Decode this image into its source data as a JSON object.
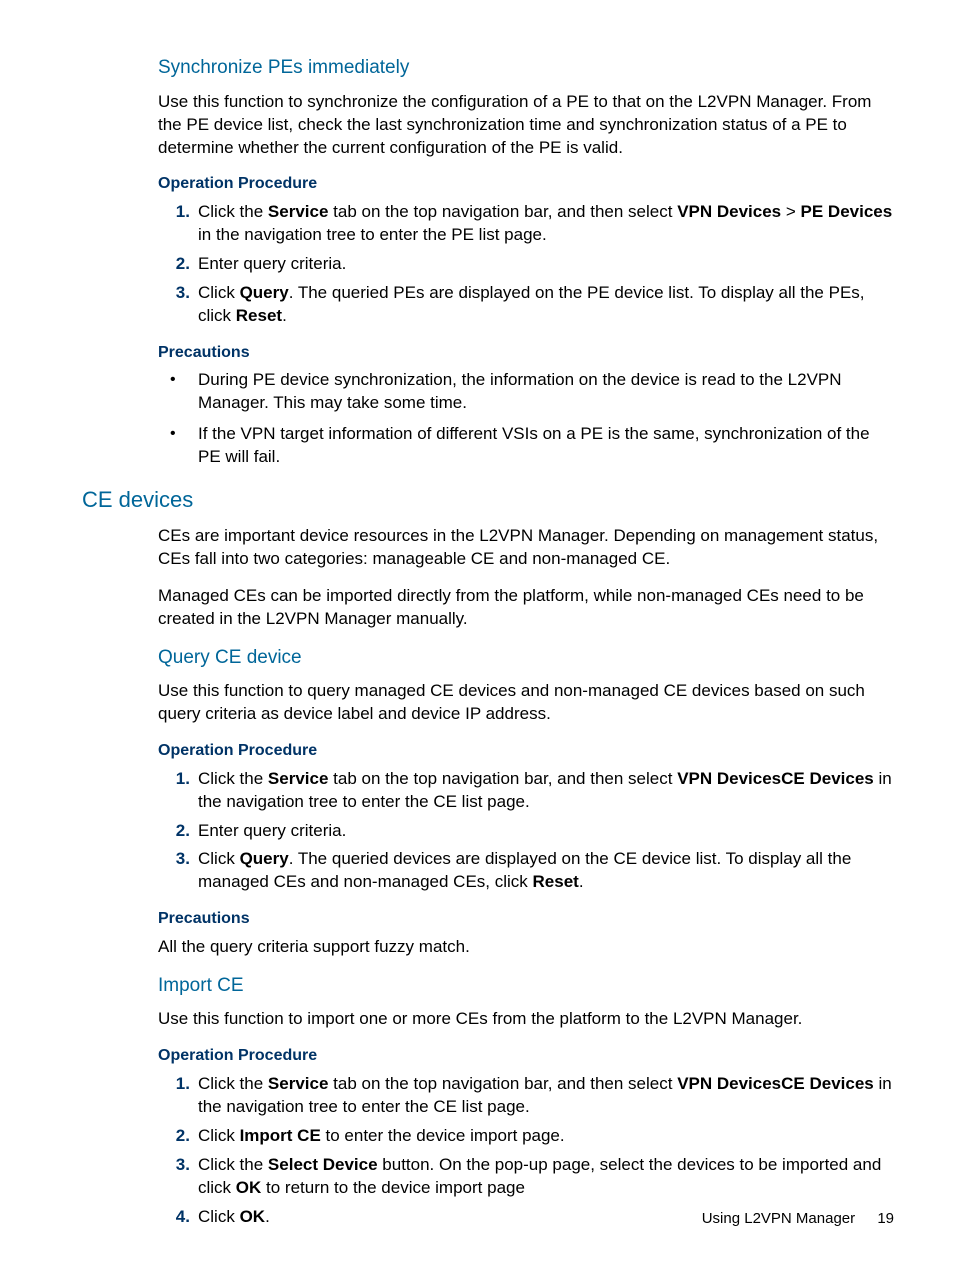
{
  "sync": {
    "title": "Synchronize PEs immediately",
    "intro": "Use this function to synchronize the configuration of a PE to that on the L2VPN Manager. From the PE device list, check the last synchronization time and synchronization status of a PE to determine whether the current configuration of the PE is valid.",
    "op_label": "Operation Procedure",
    "steps": {
      "s1a": "Click the ",
      "s1b": "Service",
      "s1c": " tab on the top navigation bar, and then select ",
      "s1d": "VPN Devices",
      "s1e": " > ",
      "s1f": "PE Devices",
      "s1g": " in the navigation tree to enter the PE list page.",
      "s2": "Enter query criteria.",
      "s3a": "Click ",
      "s3b": "Query",
      "s3c": ". The queried PEs are displayed on the PE device list. To display all the PEs, click ",
      "s3d": "Reset",
      "s3e": "."
    },
    "prec_label": "Precautions",
    "prec": {
      "p1": "During PE device synchronization, the information on the device is read to the L2VPN Manager. This may take some time.",
      "p2": "If the VPN target information of different VSIs on a PE is the same, synchronization of the PE will fail."
    }
  },
  "ce": {
    "title": "CE devices",
    "intro1": "CEs are important device resources in the L2VPN Manager. Depending on management status, CEs fall into two categories: manageable CE and non-managed CE.",
    "intro2": "Managed CEs can be imported directly from the platform, while non-managed CEs need to be created in the L2VPN Manager manually."
  },
  "query_ce": {
    "title": "Query CE device",
    "intro": "Use this function to query managed CE devices and non-managed CE devices based on such query criteria as device label and device IP address.",
    "op_label": "Operation Procedure",
    "steps": {
      "s1a": "Click the ",
      "s1b": "Service",
      "s1c": " tab on the top navigation bar, and then select ",
      "s1d": "VPN Devices",
      "s1e": "CE Devices",
      "s1f": " in the navigation tree to enter the CE list page.",
      "s2": "Enter query criteria.",
      "s3a": "Click ",
      "s3b": "Query",
      "s3c": ". The queried devices are displayed on the CE device list. To display all the managed CEs and non-managed CEs, click ",
      "s3d": "Reset",
      "s3e": "."
    },
    "prec_label": "Precautions",
    "prec": "All the query criteria support fuzzy match."
  },
  "import_ce": {
    "title": "Import CE",
    "intro": "Use this function to import one or more CEs from the platform to the L2VPN Manager.",
    "op_label": "Operation Procedure",
    "steps": {
      "s1a": "Click the ",
      "s1b": "Service",
      "s1c": " tab on the top navigation bar, and then select ",
      "s1d": "VPN Devices",
      "s1e": "CE Devices",
      "s1f": " in the navigation tree to enter the CE list page.",
      "s2a": "Click ",
      "s2b": "Import CE",
      "s2c": " to enter the device import page.",
      "s3a": "Click the ",
      "s3b": "Select Device",
      "s3c": " button. On the pop-up page, select the devices to be imported and click ",
      "s3d": "OK",
      "s3e": " to return to the device import page",
      "s4a": "Click ",
      "s4b": "OK",
      "s4c": "."
    }
  },
  "footer": {
    "section": "Using L2VPN Manager",
    "page": "19"
  }
}
